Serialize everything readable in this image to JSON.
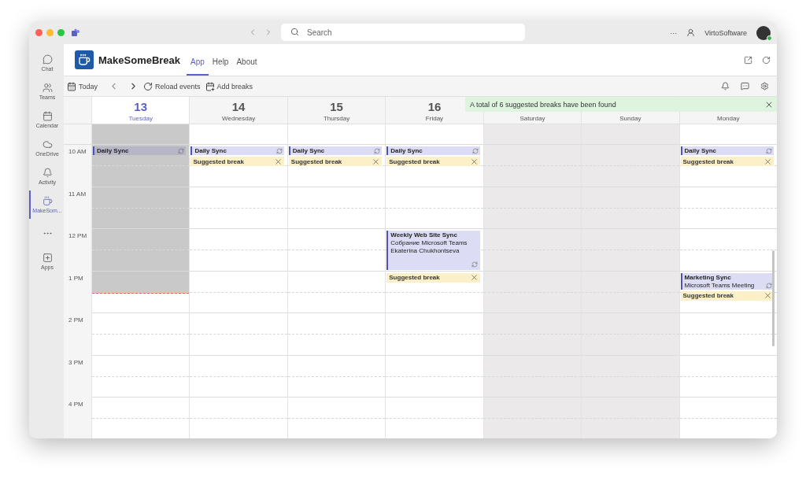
{
  "titlebar": {
    "search": {
      "placeholder": "Search"
    },
    "more": "···",
    "user": "VirtoSoftware"
  },
  "rail": [
    {
      "label": "Chat",
      "kind": "chat",
      "selected": false
    },
    {
      "label": "Teams",
      "kind": "teams",
      "selected": false
    },
    {
      "label": "Calendar",
      "kind": "calendar",
      "selected": false
    },
    {
      "label": "OneDrive",
      "kind": "cloud",
      "selected": false
    },
    {
      "label": "Activity",
      "kind": "bell",
      "selected": false
    },
    {
      "label": "MakeSom...",
      "kind": "cup",
      "selected": true
    },
    {
      "kind": "more",
      "selected": false
    },
    {
      "label": "Apps",
      "kind": "apps",
      "selected": false
    }
  ],
  "app": {
    "name": "MakeSomeBreak",
    "tabs": [
      {
        "label": "App",
        "selected": true
      },
      {
        "label": "Help",
        "selected": false
      },
      {
        "label": "About",
        "selected": false
      }
    ]
  },
  "toolbar": {
    "today": "Today",
    "reload": "Reload events",
    "add": "Add breaks"
  },
  "banner": {
    "text": "A total of 6 suggested breaks have been found"
  },
  "times": [
    "10 AM",
    "11 AM",
    "12 PM",
    "1 PM",
    "2 PM",
    "3 PM",
    "4 PM"
  ],
  "days": [
    {
      "number": "13",
      "weekday": "Tuesday",
      "selected": true,
      "weekend": false,
      "level": 0.54,
      "hours": [
        {
          "selected": false,
          "events": [
            {
              "kind": "meeting",
              "title": "Daily Sync"
            }
          ]
        }
      ]
    },
    {
      "number": "14",
      "weekday": "Wednesday",
      "selected": false,
      "weekend": false,
      "hours": [
        {
          "selected": false,
          "events": [
            {
              "kind": "meeting",
              "title": "Daily Sync"
            },
            {
              "kind": "break",
              "title": "Suggested break"
            }
          ]
        }
      ]
    },
    {
      "number": "15",
      "weekday": "Thursday",
      "selected": false,
      "weekend": false,
      "hours": [
        {
          "selected": false,
          "events": [
            {
              "kind": "meeting",
              "title": "Daily Sync"
            },
            {
              "kind": "break",
              "title": "Suggested break"
            }
          ]
        }
      ]
    },
    {
      "number": "16",
      "weekday": "Friday",
      "selected": false,
      "weekend": false,
      "hours": [
        {
          "selected": false,
          "events": [
            {
              "kind": "meeting",
              "title": "Daily Sync"
            },
            {
              "kind": "break",
              "title": "Suggested break"
            }
          ]
        },
        {
          "selected": false
        },
        {
          "selected": false,
          "events": [
            {
              "kind": "hour-meeting",
              "title": "Weekly Web Site Sync",
              "lines": [
                "Собрание Microsoft Teams",
                "Ekaterina Chukhontseva"
              ]
            }
          ]
        },
        {
          "selected": false,
          "events": [
            {
              "kind": "break",
              "title": "Suggested break"
            }
          ]
        }
      ]
    },
    {
      "weekday": "Saturday",
      "selected": false,
      "weekend": true
    },
    {
      "weekday": "Sunday",
      "selected": false,
      "weekend": true
    },
    {
      "weekday": "Monday",
      "selected": false,
      "weekend": false,
      "hours": [
        {
          "selected": false,
          "events": [
            {
              "kind": "meeting",
              "title": "Daily Sync"
            },
            {
              "kind": "break",
              "title": "Suggested break"
            }
          ]
        },
        {
          "selected": false
        },
        {
          "selected": false
        },
        {
          "selected": false,
          "events": [
            {
              "kind": "meeting",
              "title": "Marketing Sync",
              "lines": [
                "Microsoft Teams Meeting"
              ]
            },
            {
              "kind": "break",
              "title": "Suggested break"
            }
          ]
        }
      ]
    }
  ]
}
